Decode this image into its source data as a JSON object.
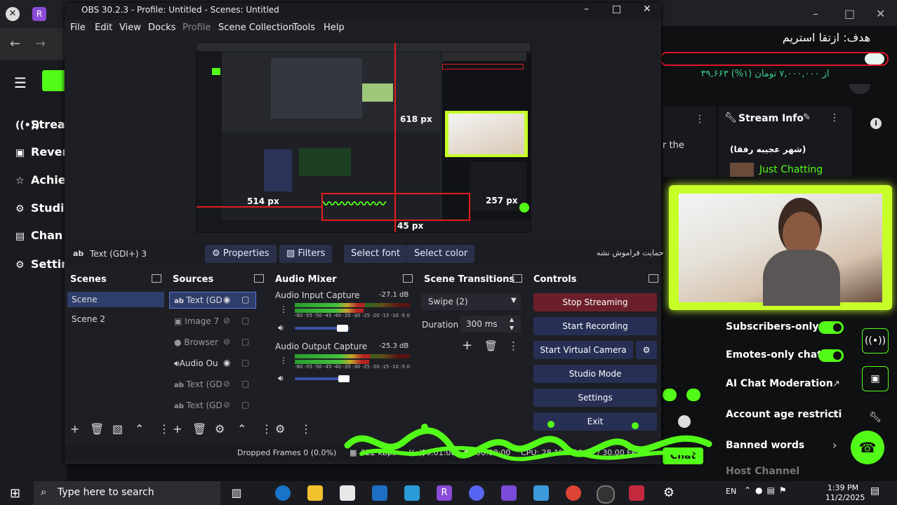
{
  "obs": {
    "title": "OBS 30.2.3 - Profile: Untitled - Scenes: Untitled",
    "menu": [
      "File",
      "Edit",
      "View",
      "Docks",
      "Profile",
      "Scene Collection",
      "Tools",
      "Help"
    ],
    "preview_labels": {
      "label_618": "618 px",
      "label_514": "514 px",
      "label_257": "257 px",
      "label_45": "45 px"
    },
    "source_toolbar": {
      "selected_source": "Text (GDI+) 3",
      "properties": "Properties",
      "filters": "Filters",
      "select_font": "Select font",
      "select_color": "Select color",
      "text_preview": "حمایت فراموش نشه"
    },
    "docks": {
      "scenes": {
        "title": "Scenes",
        "items": [
          "Scene",
          "Scene 2"
        ]
      },
      "sources": {
        "title": "Sources",
        "items": [
          "Text (GD",
          "Image 7",
          "Browser",
          "Audio Ou",
          "Text (GD",
          "Text (GD"
        ]
      },
      "audio_mixer": {
        "title": "Audio Mixer",
        "channels": [
          {
            "name": "Audio Input Capture",
            "db": "-27.1 dB",
            "level": 0.62
          },
          {
            "name": "Audio Output Capture",
            "db": "-25.3 dB",
            "level": 0.66
          }
        ],
        "scale": "-60 -55 -50 -45 -40 -35 -30 -25 -20 -15 -10 -5 0"
      },
      "transitions": {
        "title": "Scene Transitions",
        "selected": "Swipe (2)",
        "duration_label": "Duration",
        "duration_value": "300 ms"
      },
      "controls": {
        "title": "Controls",
        "buttons": [
          "Stop Streaming",
          "Start Recording",
          "Start Virtual Camera",
          "Studio Mode",
          "Settings",
          "Exit"
        ]
      }
    },
    "status": {
      "dropped": "Dropped Frames 0 (0.0%)",
      "bitrate": "822 kbps",
      "stream_time": "00:01:06",
      "rec_time": "00:00:00",
      "cpu": "CPU: 28.1%",
      "fps": "30.00 / 30.00 FPS"
    }
  },
  "kick": {
    "sidebar": [
      "Strea",
      "Rever",
      "Achie",
      "Studi",
      "Chan",
      "Settin"
    ],
    "goal_title": "هدف: ازتقا استریم",
    "goal_progress_text": "۳۹,۶۶۳ از ۷,۰۰۰,۰۰۰ تومان (۱%)",
    "goal_progress": 0.01,
    "stream_info_title": "Stream Info",
    "stream_title": "(شهر عجیبه رفقا)",
    "category": "Just Chatting",
    "partial_text": "r the",
    "settings": [
      "Subscribers-only...",
      "Emotes-only chat",
      "AI Chat Moderation",
      "Account age restricti",
      "Banned words",
      "Host Channel"
    ],
    "chat_label": "Chat"
  },
  "taskbar": {
    "search_placeholder": "Type here to search",
    "time": "1:39 PM",
    "date": "11/2/2025",
    "lang": "EN"
  },
  "colors": {
    "kick_green": "#53fc18",
    "obs_blue": "#272f55",
    "red_outline": "#e31d1d"
  }
}
